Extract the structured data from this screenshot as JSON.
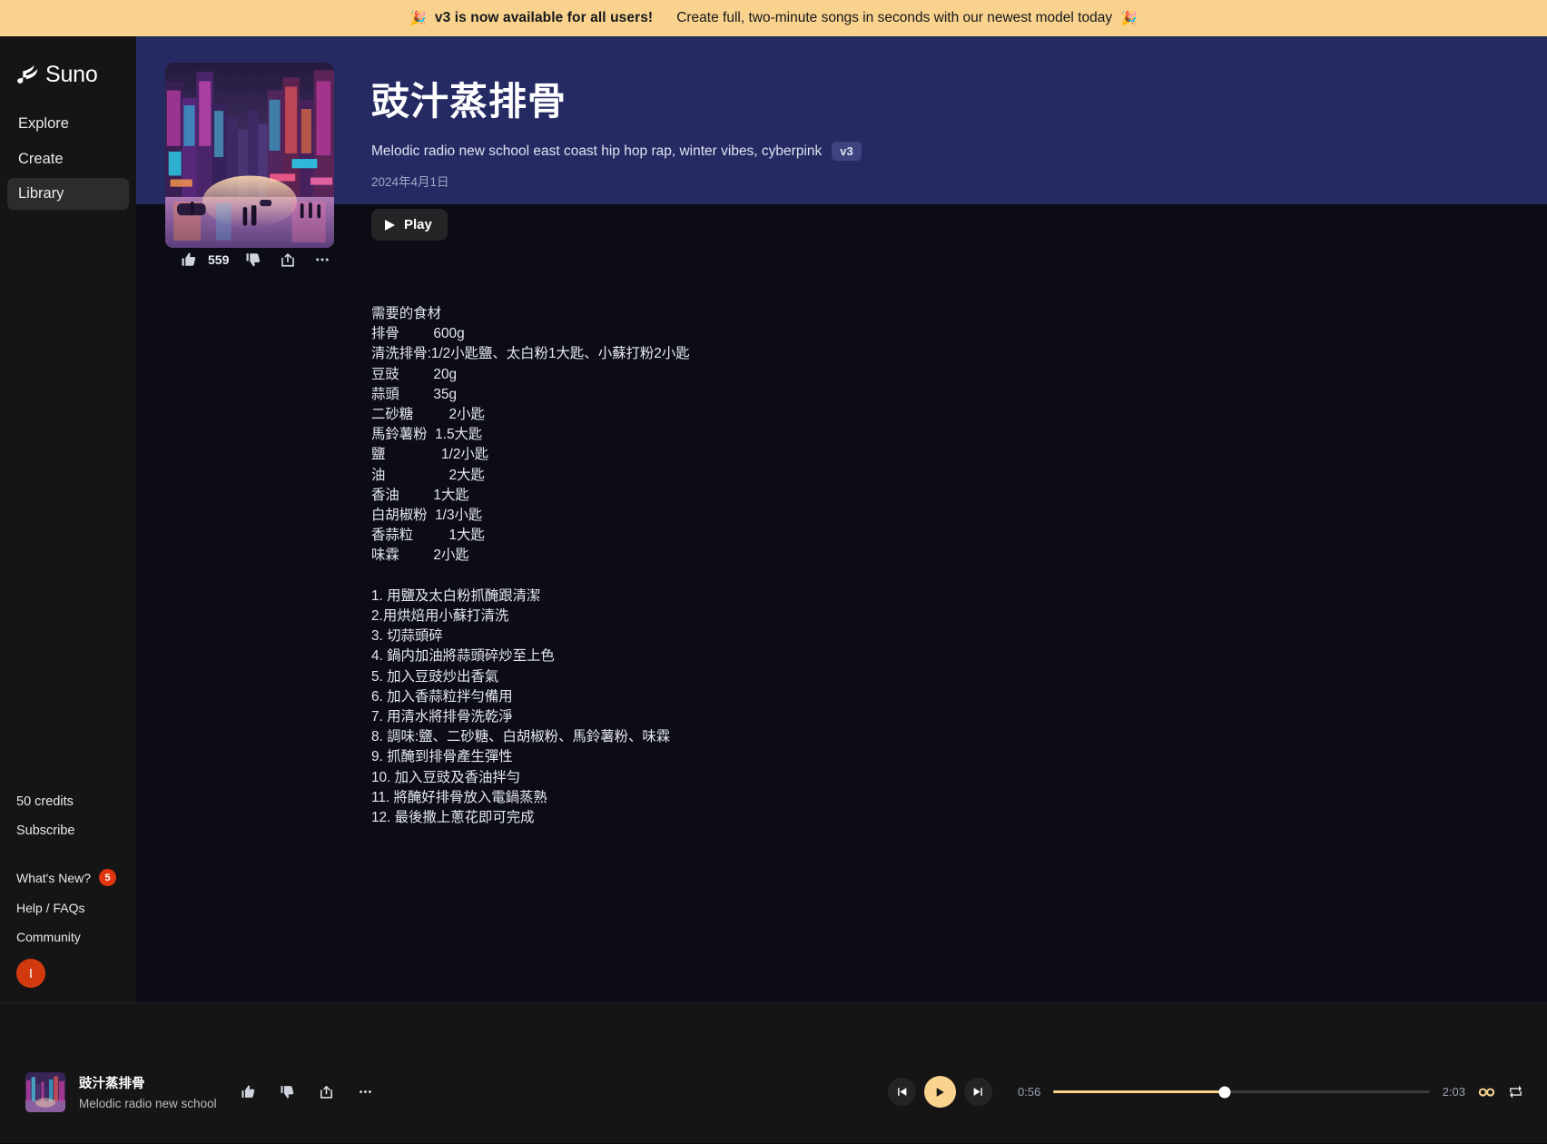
{
  "announcement": {
    "emoji_left": "🎉",
    "headline": "v3 is now available for all users!",
    "subtext": "Create full, two-minute songs in seconds with our newest model today",
    "emoji_right": "🎉"
  },
  "sidebar": {
    "brand": "Suno",
    "nav": [
      {
        "label": "Explore",
        "active": false
      },
      {
        "label": "Create",
        "active": false
      },
      {
        "label": "Library",
        "active": true
      }
    ],
    "credits": "50 credits",
    "subscribe": "Subscribe",
    "whats_new": "What's New?",
    "whats_new_count": "5",
    "help": "Help / FAQs",
    "community": "Community",
    "avatar_initial": "I"
  },
  "song": {
    "title": "豉汁蒸排骨",
    "tags": "Melodic radio new school east coast hip hop rap, winter vibes, cyberpink",
    "version": "v3",
    "date": "2024年4月1日",
    "play_label": "Play",
    "like_count": "559",
    "lyrics": "需要的食材\n排骨\t\t600g\n清洗排骨:1/2小匙鹽、太白粉1大匙、小蘇打粉2小匙\n豆豉\t\t20g\n蒜頭\t\t35g\n二砂糖\t    2小匙\n馬鈴薯粉  1.5大匙\n鹽\t          1/2小匙\n油\t\t    2大匙\n香油\t        1大匙\n白胡椒粉  1/3小匙\n香蒜粒\t    1大匙\n味霖\t        2小匙\n\n1. 用鹽及太白粉抓醃跟清潔\n2.用烘焙用小蘇打清洗\n3. 切蒜頭碎\n4. 鍋内加油將蒜頭碎炒至上色\n5. 加入豆豉炒出香氣\n6. 加入香蒜粒拌勻備用\n7. 用清水將排骨洗乾淨\n8. 調味:鹽、二砂糖、白胡椒粉、馬鈴薯粉、味霖\n9. 抓醃到排骨產生彈性\n10. 加入豆豉及香油拌勻\n11. 將醃好排骨放入電鍋蒸熟\n12. 最後撒上蔥花即可完成"
  },
  "player": {
    "now_playing_title": "豉汁蒸排骨",
    "now_playing_subtitle": "Melodic radio new school",
    "current_time": "0:56",
    "total_time": "2:03",
    "progress_percent": 45.5
  },
  "colors": {
    "banner": "#f9d28d",
    "accent": "#f9d28d",
    "hero": "#252a63",
    "badge_red": "#e0350f"
  }
}
